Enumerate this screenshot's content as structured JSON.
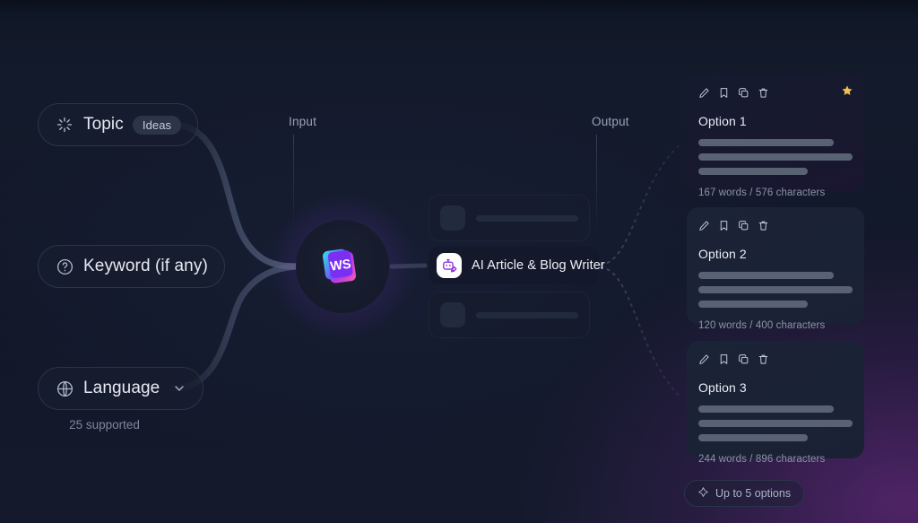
{
  "theme": {
    "background": "#111827",
    "panel": "#1b2336",
    "accent_blue": "#2f7df6",
    "accent_purple": "#a83cdc",
    "accent_magenta": "#d23bb0",
    "star_gold": "#f2c14b",
    "text_primary": "#e8ecf5",
    "text_muted": "#8b94a8"
  },
  "inputs": {
    "section_label": "Input",
    "pills": [
      {
        "label": "Topic",
        "icon": "sparkle-icon",
        "chip": "Ideas"
      },
      {
        "label": "Keyword (if any)",
        "icon": "question-circle-icon"
      },
      {
        "label": "Language",
        "icon": "globe-icon",
        "chevron": "chevron-down-icon",
        "note": "25 supported"
      }
    ]
  },
  "hub": {
    "logo_text": "WS",
    "logo_name": "ws-logo"
  },
  "tools": {
    "section_label": "Output",
    "selected": {
      "label": "AI Article & Blog Writer",
      "icon": "ai-robot-icon"
    },
    "placeholders": [
      {
        "label": ""
      },
      {
        "label": ""
      }
    ]
  },
  "results": {
    "cards": [
      {
        "title": "Option 1",
        "meta": "167 words / 576 characters",
        "selected": true,
        "starred": true,
        "actions": [
          "edit-icon",
          "bookmark-icon",
          "copy-icon",
          "delete-icon"
        ]
      },
      {
        "title": "Option 2",
        "meta": "120 words / 400 characters",
        "selected": false,
        "starred": false,
        "actions": [
          "edit-icon",
          "bookmark-icon",
          "copy-icon",
          "delete-icon"
        ]
      },
      {
        "title": "Option 3",
        "meta": "244 words / 896 characters",
        "selected": false,
        "starred": false,
        "actions": [
          "edit-icon",
          "bookmark-icon",
          "copy-icon",
          "delete-icon"
        ]
      }
    ],
    "footer_pill": {
      "label": "Up to 5 options",
      "icon": "sparkle-diamond-icon"
    }
  }
}
